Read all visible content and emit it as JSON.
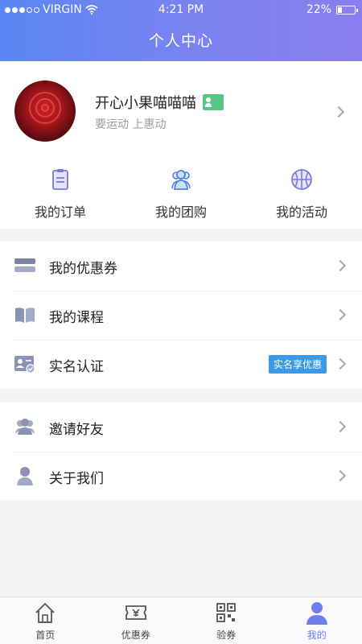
{
  "status_bar": {
    "carrier": "VIRGIN",
    "time": "4:21 PM",
    "battery": "22%",
    "battery_level": 0.22
  },
  "header": {
    "title": "个人中心"
  },
  "profile": {
    "nickname": "开心小果喵喵喵",
    "motto": "要运动 上惠动"
  },
  "quick_actions": [
    {
      "label": "我的订单",
      "icon": "order-list-icon"
    },
    {
      "label": "我的团购",
      "icon": "group-buy-icon"
    },
    {
      "label": "我的活动",
      "icon": "basketball-icon"
    }
  ],
  "menu_group1": [
    {
      "label": "我的优惠券",
      "icon": "coupon-icon"
    },
    {
      "label": "我的课程",
      "icon": "book-icon"
    },
    {
      "label": "实名认证",
      "icon": "id-card-icon",
      "tag": "实名享优惠"
    }
  ],
  "menu_group2": [
    {
      "label": "邀请好友",
      "icon": "friends-icon"
    },
    {
      "label": "关于我们",
      "icon": "person-icon"
    }
  ],
  "tabbar": [
    {
      "label": "首页",
      "icon": "home-icon"
    },
    {
      "label": "优惠券",
      "icon": "ticket-icon"
    },
    {
      "label": "验券",
      "icon": "qr-code-icon"
    },
    {
      "label": "我的",
      "icon": "user-icon",
      "active": true
    }
  ],
  "colors": {
    "header_start": "#5a86f3",
    "header_end": "#8a7eee",
    "accent": "#6d7ff0",
    "tag": "#3a9ae8",
    "verify": "#58c786"
  }
}
